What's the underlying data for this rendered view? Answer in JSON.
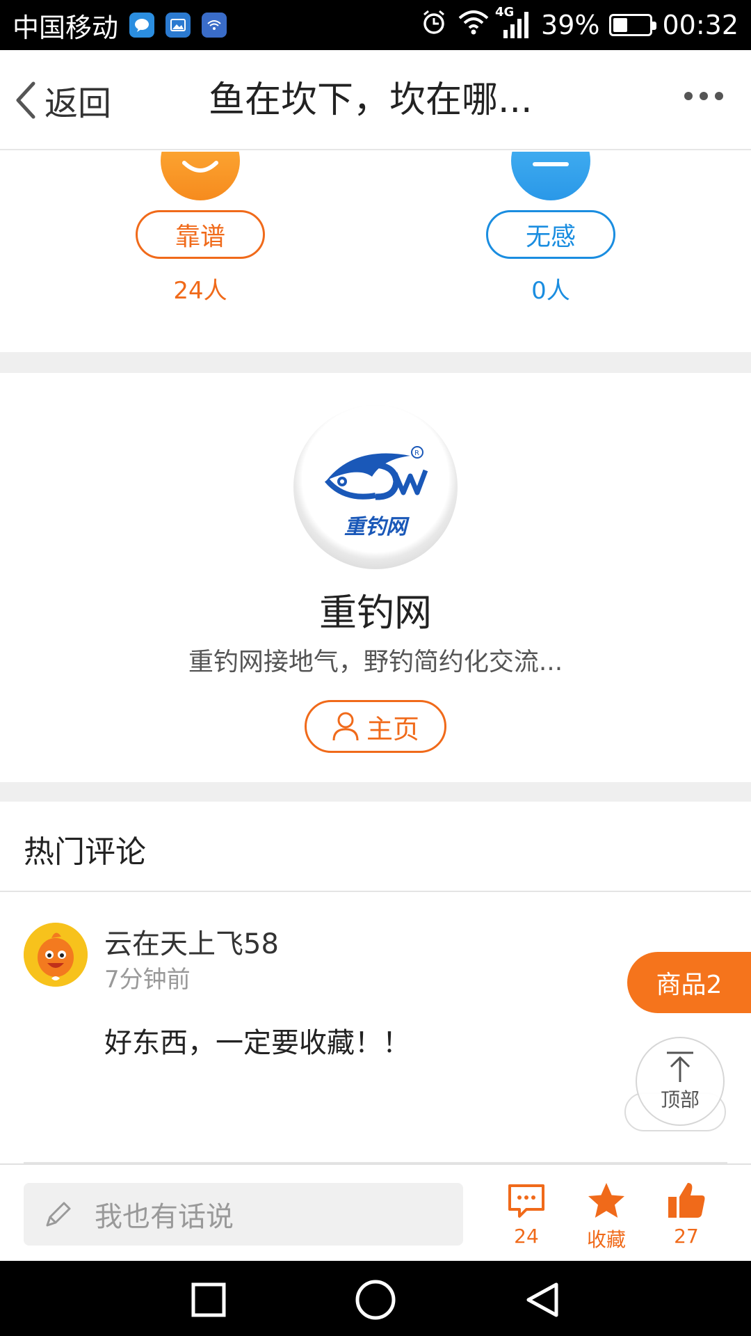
{
  "status_bar": {
    "carrier": "中国移动",
    "network": "4G",
    "battery": "39%",
    "battery_level": 0.39,
    "time": "00:32"
  },
  "header": {
    "back_label": "返回",
    "title": "鱼在坎下，坎在哪..."
  },
  "rating": {
    "positive": {
      "label": "靠谱",
      "count": "24人",
      "color": "#f06a1a"
    },
    "neutral": {
      "label": "无感",
      "count": "0人",
      "color": "#1a8de0"
    }
  },
  "author": {
    "logo_text": "重钓网",
    "name": "重钓网",
    "description": "重钓网接地气，野钓简约化交流...",
    "home_label": "主页"
  },
  "comments": {
    "section_title": "热门评论",
    "items": [
      {
        "user": "云在天上飞58",
        "time": "7分钟前",
        "text": "好东西，一定要收藏！！"
      }
    ]
  },
  "floating": {
    "goods_label": "商品2",
    "top_label": "顶部"
  },
  "action_bar": {
    "input_placeholder": "我也有话说",
    "comment_count": "24",
    "favorite_label": "收藏",
    "like_count": "27",
    "accent": "#f06a1a"
  }
}
